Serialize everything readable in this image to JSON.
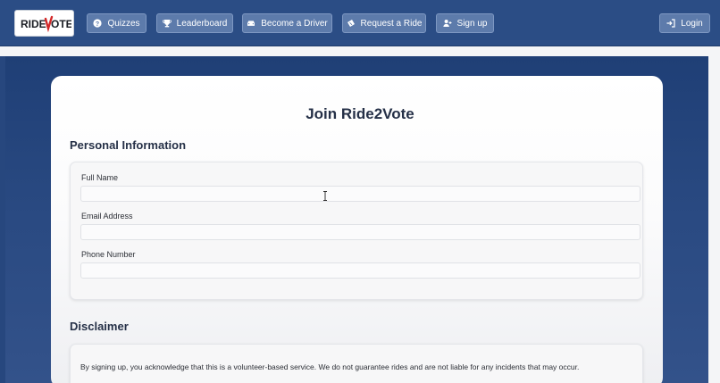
{
  "nav": {
    "logo_text": "RIDE2VOTE",
    "items": [
      {
        "label": "Quizzes",
        "icon": "question-circle-icon"
      },
      {
        "label": "Leaderboard",
        "icon": "trophy-icon"
      },
      {
        "label": "Become a Driver",
        "icon": "car-icon"
      },
      {
        "label": "Request a Ride",
        "icon": "ticket-icon"
      },
      {
        "label": "Sign up",
        "icon": "user-plus-icon"
      }
    ],
    "login": {
      "label": "Login",
      "icon": "sign-in-icon"
    }
  },
  "form": {
    "title": "Join Ride2Vote",
    "personal_section": "Personal Information",
    "fields": [
      {
        "label": "Full Name",
        "value": "",
        "placeholder": ""
      },
      {
        "label": "Email Address",
        "value": "",
        "placeholder": ""
      },
      {
        "label": "Phone Number",
        "value": "",
        "placeholder": ""
      }
    ],
    "disclaimer_section": "Disclaimer",
    "disclaimer_text": "By signing up, you acknowledge that this is a volunteer-based service. We do not guarantee rides and are not liable for any incidents that may occur."
  },
  "colors": {
    "nav_bg": "#2b4d85",
    "nav_button": "#5d7bab",
    "page_bg": "#27477e",
    "logo_red": "#d32a2a",
    "title_text": "#253047"
  }
}
